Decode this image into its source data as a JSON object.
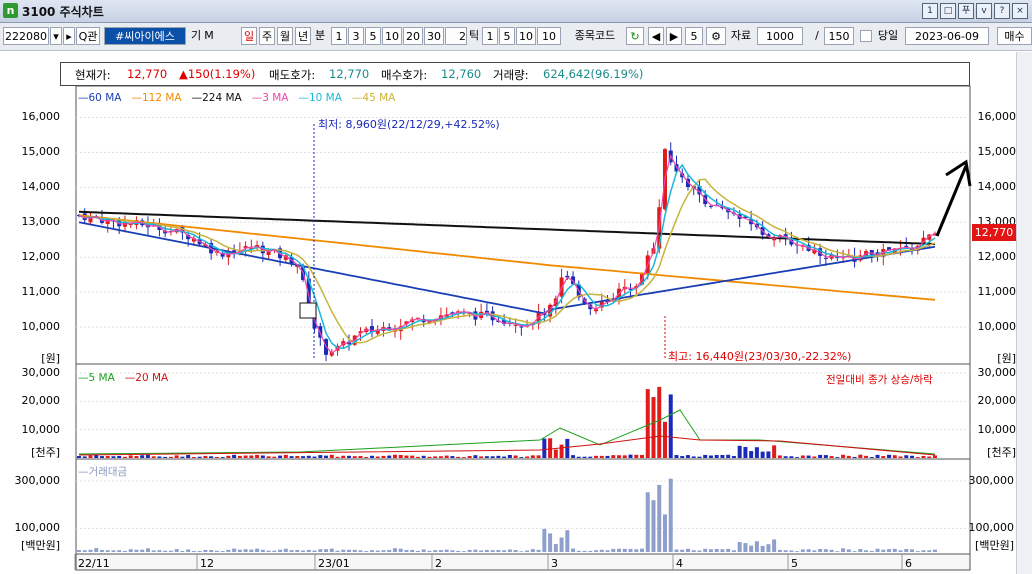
{
  "window": {
    "icon": "n",
    "title": "3100 주식차트",
    "buttons": [
      "1",
      "□",
      "푸",
      "v",
      "?",
      "×"
    ]
  },
  "toolbar": {
    "code": "222080",
    "search_icon": "Q",
    "search_label": "관",
    "name": "#씨아이에스",
    "tag1": "기",
    "tag2": "M",
    "periods": [
      "일",
      "주",
      "월",
      "년"
    ],
    "minute_label": "분",
    "minutes": [
      "1",
      "3",
      "5",
      "10",
      "20",
      "30"
    ],
    "tick_value": "2",
    "tick_label": "틱",
    "ticks": [
      "1",
      "5",
      "10"
    ],
    "tick_input": "10",
    "code_label": "종목코드",
    "count_value": "5",
    "data_label": "자료",
    "data_value": "1000",
    "slash": "/",
    "count2": "150",
    "today_label": "당일",
    "date": "2023-06-09",
    "more": "매수"
  },
  "info": {
    "cur_label": "현재가:",
    "cur": "12,770",
    "chg": "▲150(1.19%)",
    "ask_label": "매도호가:",
    "ask": "12,770",
    "bid_label": "매수호가:",
    "bid": "12,760",
    "vol_label": "거래량:",
    "vol": "624,642(96.19%)"
  },
  "legends": {
    "price": [
      {
        "name": "60 MA",
        "color": "#1a3fb5"
      },
      {
        "name": "112 MA",
        "color": "#f28a00"
      },
      {
        "name": "224 MA",
        "color": "#111111"
      },
      {
        "name": "3 MA",
        "color": "#ee44aa"
      },
      {
        "name": "10 MA",
        "color": "#1ab8d8"
      },
      {
        "name": "45 MA",
        "color": "#c8b43a"
      }
    ],
    "volume": [
      {
        "name": "5 MA",
        "color": "#1aa01a"
      },
      {
        "name": "20 MA",
        "color": "#d01010"
      }
    ],
    "amount": [
      {
        "name": "거래대금",
        "color": "#8899bb"
      }
    ]
  },
  "volume_right_label": "전일대비 종가 상승/하락",
  "annotations": {
    "low": "최저: 8,960원(22/12/29,+42.52%)",
    "high": "최고: 16,440원(23/03/30,-22.32%)"
  },
  "price_box": "12,770",
  "axes": {
    "price_ticks": [
      "16,000",
      "15,000",
      "14,000",
      "13,000",
      "12,000",
      "11,000",
      "10,000"
    ],
    "price_unit": "[원]",
    "vol_ticks": [
      "30,000",
      "20,000",
      "10,000"
    ],
    "vol_unit": "[천주]",
    "amt_ticks": [
      "300,000",
      "100,000"
    ],
    "amt_unit": "[백만원]",
    "x_labels": [
      "22/11",
      "12",
      "23/01",
      "2",
      "3",
      "4",
      "5",
      "6"
    ]
  },
  "chart_data": {
    "type": "candlestick",
    "x": [
      "22/11",
      "12",
      "23/01",
      "2",
      "3",
      "4",
      "5",
      "6"
    ],
    "close_approx": [
      13200,
      12400,
      10200,
      10500,
      11200,
      14200,
      12000,
      12770
    ],
    "ylim": [
      9000,
      16500
    ],
    "vol_ylim": [
      0,
      30000
    ],
    "amt_ylim": [
      0,
      380000
    ]
  },
  "colors": {
    "up": "#e01b1b",
    "down": "#1a2ab8",
    "grid": "#d9d9d9"
  }
}
